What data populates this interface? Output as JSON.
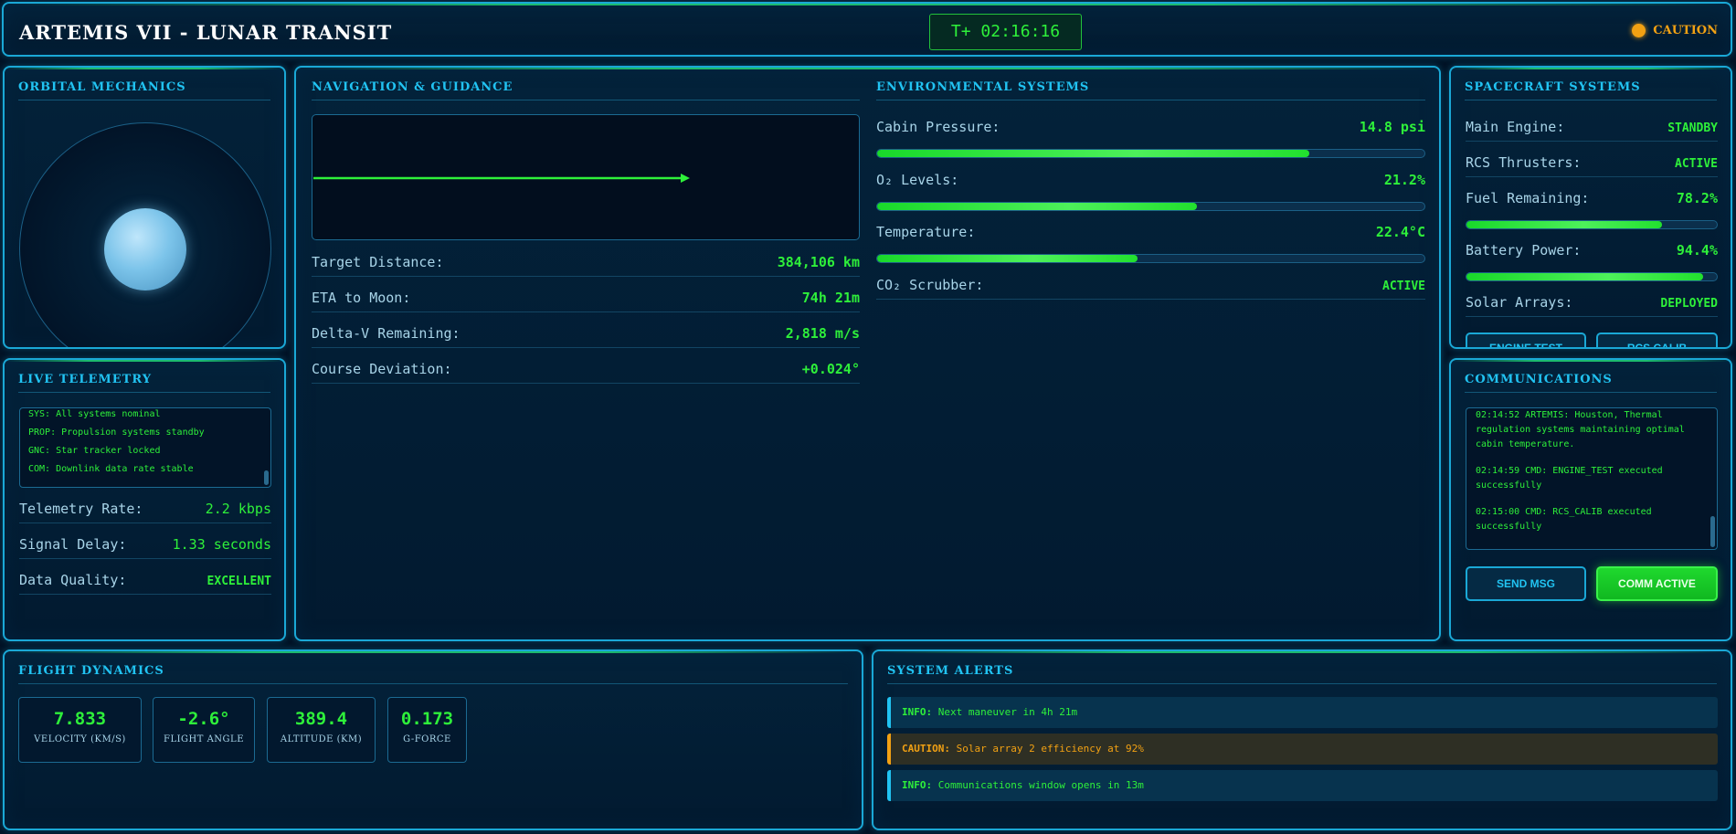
{
  "header": {
    "title": "ARTEMIS VII - LUNAR TRANSIT",
    "mission_time": "T+ 02:16:16",
    "status": "CAUTION",
    "status_color": "#f2a113"
  },
  "orbital": {
    "title": "ORBITAL MECHANICS"
  },
  "telemetry": {
    "title": "LIVE TELEMETRY",
    "log": [
      "SYS: All systems nominal",
      "PROP: Propulsion systems standby",
      "GNC: Star tracker locked",
      "COM: Downlink data rate stable"
    ],
    "rows": [
      {
        "label": "Telemetry Rate:",
        "value": "2.2 kbps"
      },
      {
        "label": "Signal Delay:",
        "value": "1.33 seconds"
      },
      {
        "label": "Data Quality:",
        "value": "EXCELLENT"
      }
    ]
  },
  "navigation": {
    "title": "NAVIGATION & GUIDANCE",
    "rows": [
      {
        "label": "Target Distance:",
        "value": "384,106 km"
      },
      {
        "label": "ETA to Moon:",
        "value": "74h 21m"
      },
      {
        "label": "Delta-V Remaining:",
        "value": "2,818 m/s"
      },
      {
        "label": "Course Deviation:",
        "value": "+0.024°"
      }
    ]
  },
  "environmental": {
    "title": "ENVIRONMENTAL SYSTEMS",
    "rows": [
      {
        "label": "Cabin Pressure:",
        "value": "14.8 psi",
        "fill": 0.79
      },
      {
        "label": "O₂ Levels:",
        "value": "21.2%",
        "fill": 0.585
      },
      {
        "label": "Temperature:",
        "value": "22.4°C",
        "fill": 0.476
      },
      {
        "label": "CO₂ Scrubber:",
        "value": "ACTIVE"
      }
    ]
  },
  "spacecraft": {
    "title": "SPACECRAFT SYSTEMS",
    "rows": [
      {
        "label": "Main Engine:",
        "value": "STANDBY"
      },
      {
        "label": "RCS Thrusters:",
        "value": "ACTIVE"
      },
      {
        "label": "Fuel Remaining:",
        "value": "78.2%",
        "fill": 0.782
      },
      {
        "label": "Battery Power:",
        "value": "94.4%",
        "fill": 0.944
      },
      {
        "label": "Solar Arrays:",
        "value": "DEPLOYED"
      }
    ],
    "buttons": {
      "engine_test": "ENGINE TEST",
      "rcs_calib": "RCS CALIB"
    }
  },
  "communications": {
    "title": "COMMUNICATIONS",
    "messages": [
      "02:14:52 ARTEMIS: Houston, Thermal regulation systems maintaining optimal cabin temperature.",
      "02:14:59 CMD: ENGINE_TEST executed successfully",
      "02:15:00 CMD: RCS_CALIB executed successfully"
    ],
    "send_label": "SEND MSG",
    "comm_label": "COMM ACTIVE"
  },
  "flight_dynamics": {
    "title": "FLIGHT DYNAMICS",
    "boxes": [
      {
        "value": "7.833",
        "label": "VELOCITY (KM/S)"
      },
      {
        "value": "-2.6°",
        "label": "FLIGHT ANGLE"
      },
      {
        "value": "389.4",
        "label": "ALTITUDE (KM)"
      },
      {
        "value": "0.173",
        "label": "G-FORCE"
      }
    ]
  },
  "alerts": {
    "title": "SYSTEM ALERTS",
    "items": [
      {
        "level": "INFO:",
        "text": "Next maneuver in 4h 21m"
      },
      {
        "level": "CAUTION:",
        "text": "Solar array 2 efficiency at 92%"
      },
      {
        "level": "INFO:",
        "text": "Communications window opens in 13m"
      }
    ]
  }
}
